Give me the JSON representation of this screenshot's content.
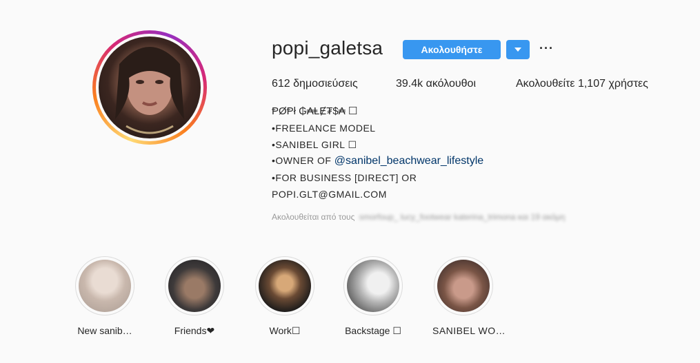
{
  "profile": {
    "username": "popi_galetsa",
    "follow_label": "Ακολουθήστε",
    "more_label": "···"
  },
  "stats": {
    "posts": "612 δημοσιεύσεις",
    "followers": "39.4k ακόλουθοι",
    "following": "Ακολουθείτε 1,107 χρήστες"
  },
  "bio": {
    "name": "ⱣØⱣł ₲₳ⱠɆ₮$₳ ☐",
    "line1": "•FREELANCE MODEL",
    "line2": "•SANIBEL GIRL ☐",
    "line3_prefix": "•OWNER OF ",
    "line3_mention": "@sanibel_beachwear_lifestyle",
    "line4": "•FOR BUSINESS [DIRECT] OR",
    "line5": "POPI.GLT@GMAIL.COM"
  },
  "followed_by": {
    "prefix": "Ακολουθείται από τους",
    "names_blurred": "smorfoup_ lucy_footwear katerina_trimona και 19 ακόμη"
  },
  "highlights": [
    {
      "label": "New sanib…"
    },
    {
      "label": "Friends❤"
    },
    {
      "label": "Work☐"
    },
    {
      "label": "Backstage ☐"
    },
    {
      "label": "SANIBEL WO…"
    }
  ],
  "colors": {
    "follow_blue": "#3897f0",
    "mention_blue": "#003569",
    "background": "#fafafa"
  }
}
